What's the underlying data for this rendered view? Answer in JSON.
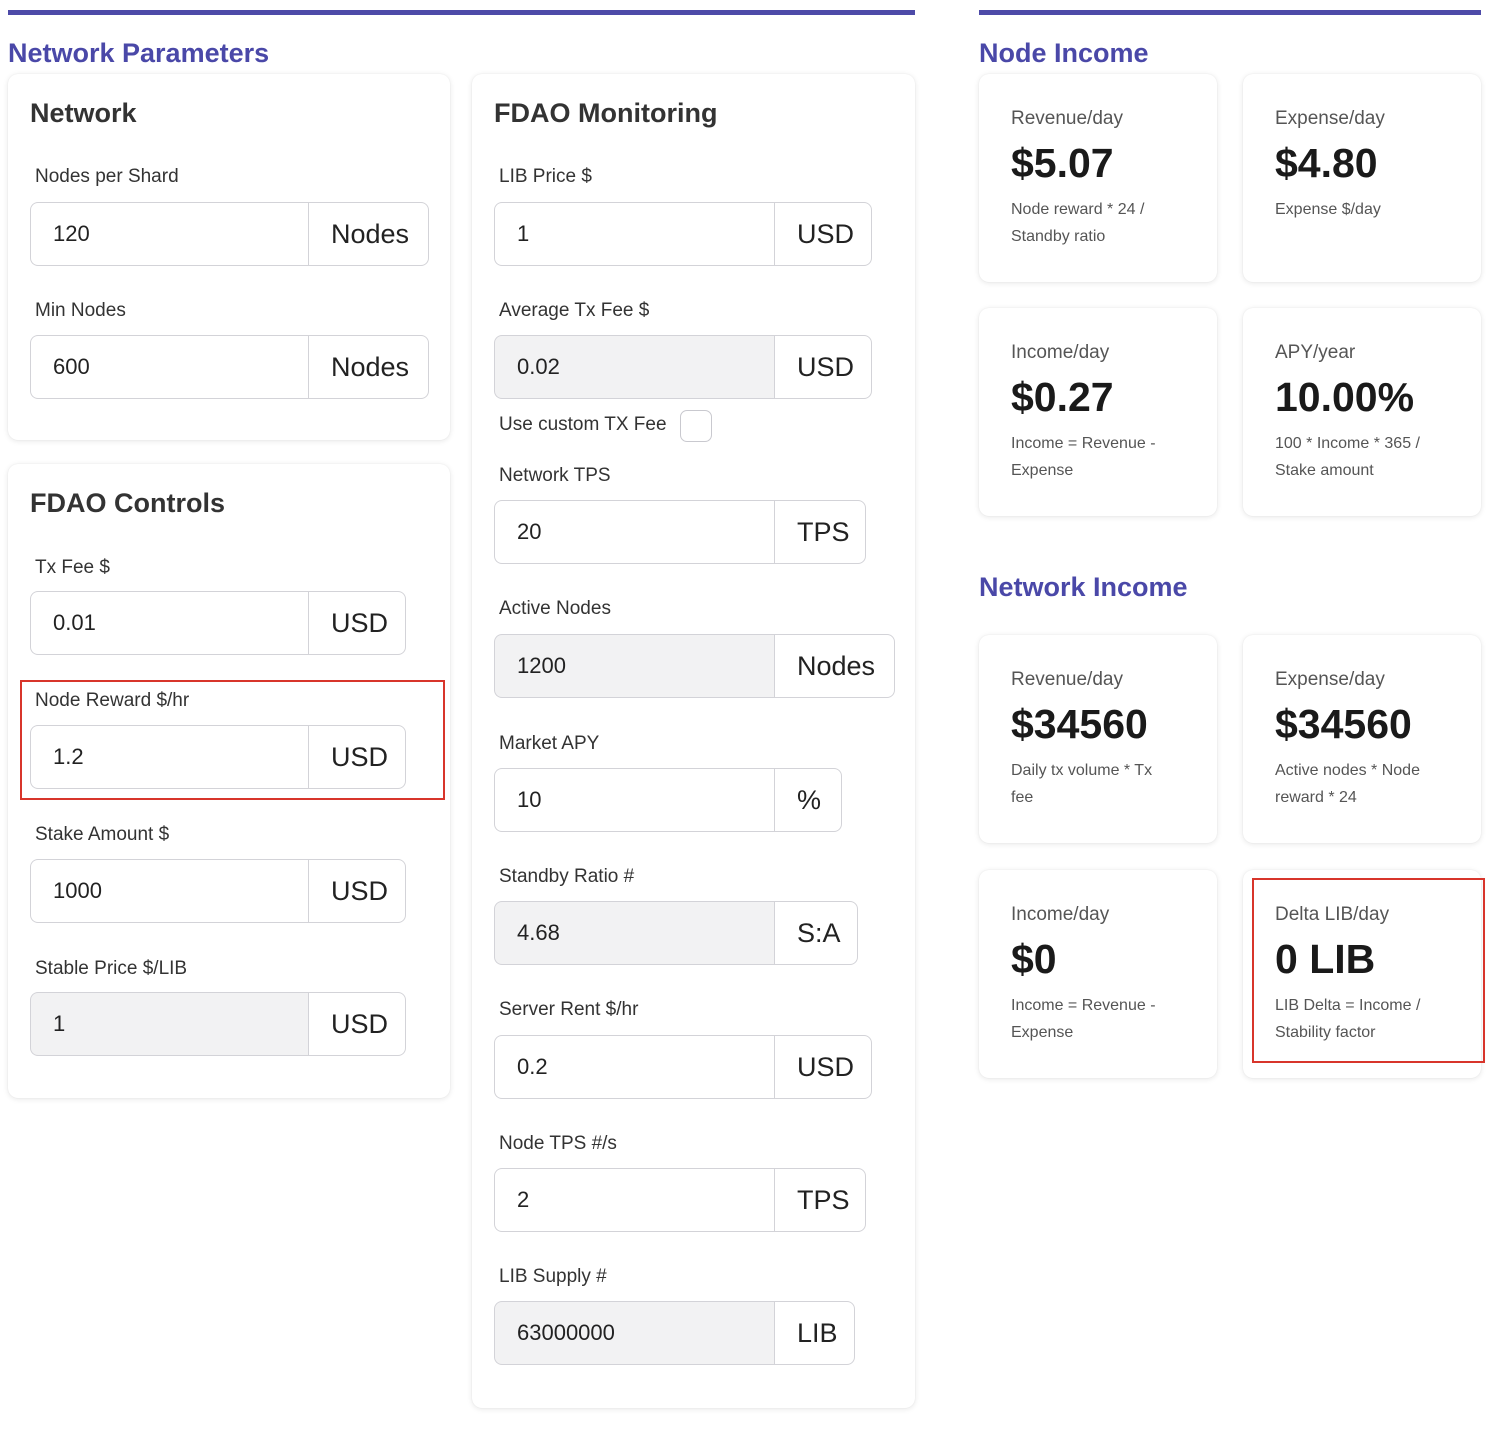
{
  "sections": {
    "network_parameters": "Network Parameters",
    "node_income": "Node Income",
    "network_income": "Network Income"
  },
  "network": {
    "title": "Network",
    "nodes_per_shard": {
      "label": "Nodes per Shard",
      "value": "120",
      "unit": "Nodes"
    },
    "min_nodes": {
      "label": "Min Nodes",
      "value": "600",
      "unit": "Nodes"
    }
  },
  "fdao_controls": {
    "title": "FDAO Controls",
    "tx_fee": {
      "label": "Tx Fee $",
      "value": "0.01",
      "unit": "USD"
    },
    "node_reward": {
      "label": "Node Reward $/hr",
      "value": "1.2",
      "unit": "USD"
    },
    "stake_amount": {
      "label": "Stake Amount $",
      "value": "1000",
      "unit": "USD"
    },
    "stable_price": {
      "label": "Stable Price $/LIB",
      "value": "1",
      "unit": "USD"
    }
  },
  "fdao_monitoring": {
    "title": "FDAO Monitoring",
    "lib_price": {
      "label": "LIB Price $",
      "value": "1",
      "unit": "USD"
    },
    "avg_tx_fee": {
      "label": "Average Tx Fee $",
      "value": "0.02",
      "unit": "USD"
    },
    "custom_tx_fee": {
      "label": "Use custom TX Fee",
      "checked": false
    },
    "network_tps": {
      "label": "Network TPS",
      "value": "20",
      "unit": "TPS"
    },
    "active_nodes": {
      "label": "Active Nodes",
      "value": "1200",
      "unit": "Nodes"
    },
    "market_apy": {
      "label": "Market APY",
      "value": "10",
      "unit": "%"
    },
    "standby_ratio": {
      "label": "Standby Ratio #",
      "value": "4.68",
      "unit": "S:A"
    },
    "server_rent": {
      "label": "Server Rent $/hr",
      "value": "0.2",
      "unit": "USD"
    },
    "node_tps": {
      "label": "Node TPS #/s",
      "value": "2",
      "unit": "TPS"
    },
    "lib_supply": {
      "label": "LIB Supply #",
      "value": "63000000",
      "unit": "LIB"
    }
  },
  "node_income": {
    "revenue": {
      "label": "Revenue/day",
      "value": "$5.07",
      "desc": "Node reward * 24 / Standby ratio"
    },
    "expense": {
      "label": "Expense/day",
      "value": "$4.80",
      "desc": "Expense $/day"
    },
    "income": {
      "label": "Income/day",
      "value": "$0.27",
      "desc": "Income = Revenue - Expense"
    },
    "apy": {
      "label": "APY/year",
      "value": "10.00%",
      "desc": "100 * Income * 365 / Stake amount"
    }
  },
  "network_income": {
    "revenue": {
      "label": "Revenue/day",
      "value": "$34560",
      "desc": "Daily tx volume * Tx fee"
    },
    "expense": {
      "label": "Expense/day",
      "value": "$34560",
      "desc": "Active nodes * Node reward * 24"
    },
    "income": {
      "label": "Income/day",
      "value": "$0",
      "desc": "Income = Revenue - Expense"
    },
    "delta_lib": {
      "label": "Delta LIB/day",
      "value": "0 LIB",
      "desc": "LIB Delta = Income / Stability factor"
    }
  },
  "colors": {
    "accent": "#4a48a8",
    "highlight": "#d8352b",
    "readonly_bg": "#f2f2f3"
  }
}
